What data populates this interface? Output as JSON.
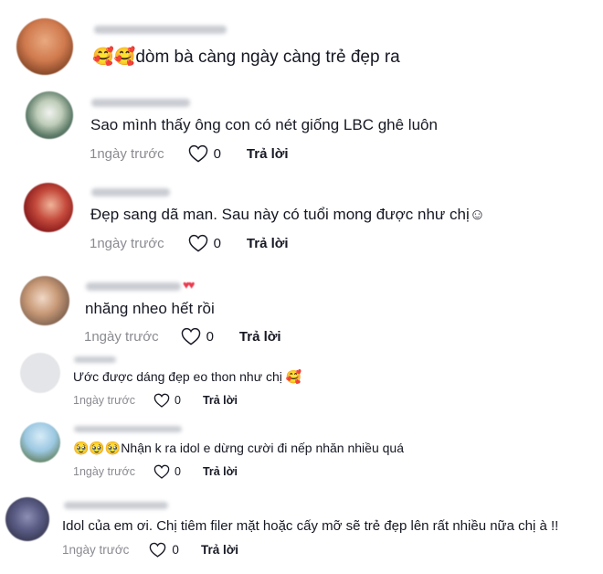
{
  "comments": [
    {
      "text": "🥰🥰dòm bà càng ngày càng trẻ đẹp ra",
      "time": "",
      "likes": "",
      "reply": ""
    },
    {
      "text": "Sao mình thấy ông con có nét giống LBC ghê luôn",
      "time": "1ngày trước",
      "likes": "0",
      "reply": "Trả lời"
    },
    {
      "text": "Đẹp sang dã man. Sau này có tuổi mong được như chị☺",
      "time": "1ngày trước",
      "likes": "0",
      "reply": "Trả lời"
    },
    {
      "text": "nhăng nheo hết rồi",
      "time": "1ngày trước",
      "likes": "0",
      "reply": "Trả lời"
    },
    {
      "text": "Ước được dáng đẹp eo thon như chị 🥰",
      "time": "1ngày trước",
      "likes": "0",
      "reply": "Trả lời"
    },
    {
      "text": "🥹🥹🥹Nhận k ra idol e dừng cười đi nếp nhăn nhiều quá",
      "time": "1ngày trước",
      "likes": "0",
      "reply": "Trả lời"
    },
    {
      "text": "Idol của em ơi. Chị tiêm filer mặt hoặc cấy mỡ sẽ trẻ đẹp lên rất nhiều nữa chị à !!",
      "time": "1ngày trước",
      "likes": "0",
      "reply": "Trả lời"
    }
  ],
  "colors": {
    "text": "#161823",
    "meta": "#8a8b91",
    "blurred_name": "#c9ccd2",
    "heart_deco": "#e8394d"
  },
  "icons": {
    "like": "heart-outline-icon"
  }
}
